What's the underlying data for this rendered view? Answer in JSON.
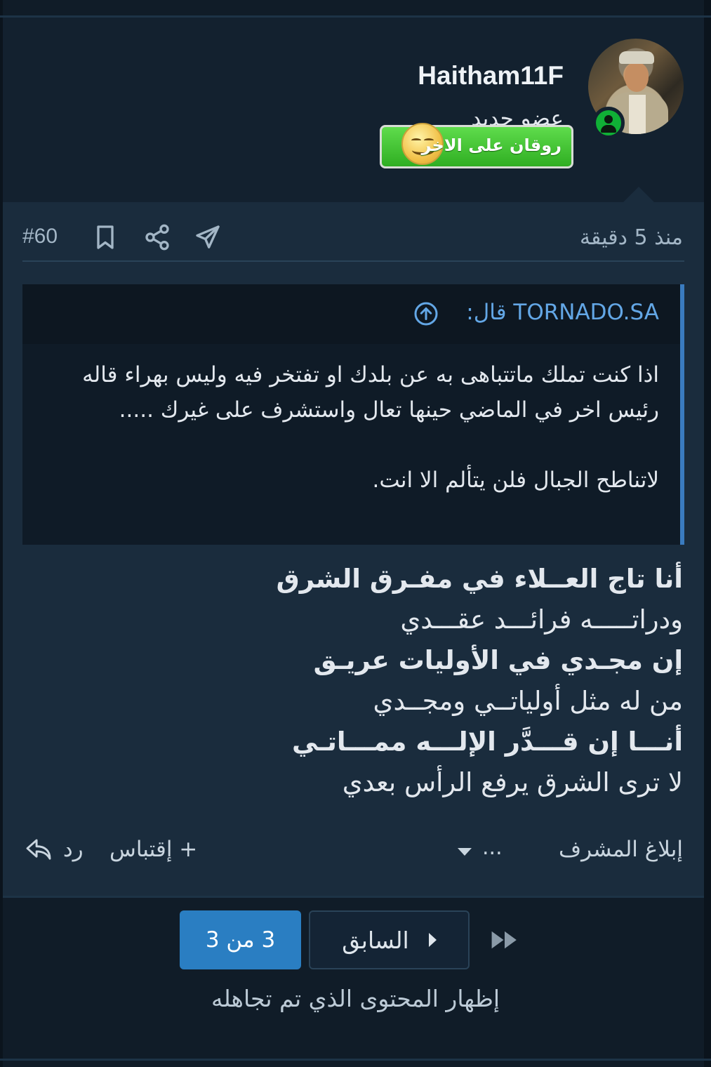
{
  "user": {
    "username": "Haitham11F",
    "title": "عضو جديد",
    "badge_text": "روقان على الاخر",
    "online": true
  },
  "post": {
    "time_ago": "منذ 5 دقيقة",
    "number": "#60",
    "quote": {
      "attribution": "TORNADO.SA قال:",
      "paragraphs": [
        "اذا كنت تملك ماتتباهى به عن بلدك او تفتخر فيه وليس بهراء قاله رئيس اخر في الماضي حينها تعال واستشرف على غيرك .....",
        "لاتناطح الجبال فلن يتألم الا انت."
      ]
    },
    "poem_lines": [
      {
        "text": "أنا تاج العــلاء في مفـرق الشرق",
        "bold": true
      },
      {
        "text": "ودراتـــــه فرائـــد عقـــدي",
        "bold": false
      },
      {
        "text": "إن مجـدي في الأوليات عريـق",
        "bold": true
      },
      {
        "text": "من له مثل أولياتــي ومجــدي",
        "bold": false
      },
      {
        "text": "أنـــا إن قـــدَّر الإلـــه ممـــاتـي",
        "bold": true
      },
      {
        "text": "لا ترى الشرق يرفع الرأس بعدي",
        "bold": false
      }
    ],
    "actions": {
      "report": "إبلاغ المشرف",
      "more": "...",
      "quote": "+ إقتباس",
      "reply": "رد"
    }
  },
  "pagination": {
    "current": "3 من 3",
    "prev_label": "السابق"
  },
  "show_ignored": "إظهار المحتوى الذي تم تجاهله",
  "colors": {
    "background": "#101c28",
    "post_bg": "#1a2c3d",
    "accent": "#2a7ec2",
    "online": "#10b036",
    "badge_green": "#3cc22e"
  }
}
